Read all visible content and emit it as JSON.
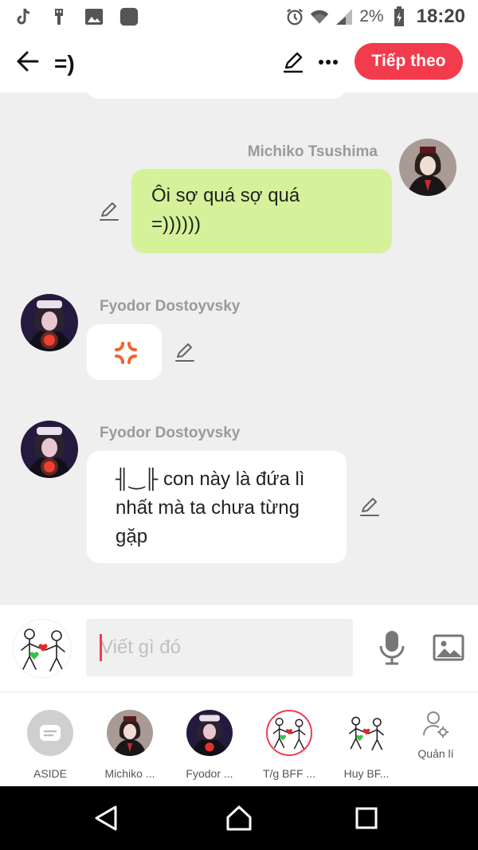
{
  "status_bar": {
    "left_icons": [
      "tiktok-icon",
      "usb-icon",
      "gallery-icon",
      "app-icon"
    ],
    "right_icons": [
      "alarm-icon",
      "wifi-icon",
      "signal-icon",
      "battery-icon"
    ],
    "battery_percent": "2%",
    "time": "18:20"
  },
  "header": {
    "title": "=)",
    "next_button_label": "Tiếp theo",
    "accent_color": "#f23b4d"
  },
  "messages": [
    {
      "sender": "Michiko Tsushima",
      "side": "right",
      "text_lines": [
        "Ôi sợ quá sợ quá",
        "=))))))"
      ],
      "bubble_color": "#d5f29a"
    },
    {
      "sender": "Fyodor Dostoyvsky",
      "side": "left",
      "content": "anger-icon",
      "bubble_color": "#ffffff"
    },
    {
      "sender": "Fyodor Dostoyvsky",
      "side": "left",
      "text_lines": [
        "╢‿╟ con này là đứa lì",
        "nhất mà ta chưa từng",
        "gặp"
      ],
      "bubble_color": "#ffffff"
    }
  ],
  "composer": {
    "placeholder": "Viết gì đó"
  },
  "character_bar": {
    "items": [
      {
        "label": "ASIDE"
      },
      {
        "label": "Michiko ..."
      },
      {
        "label": "Fyodor ..."
      },
      {
        "label": "T/g BFF ..."
      },
      {
        "label": "Huy BF..."
      }
    ],
    "manage_label": "Quản lí"
  }
}
